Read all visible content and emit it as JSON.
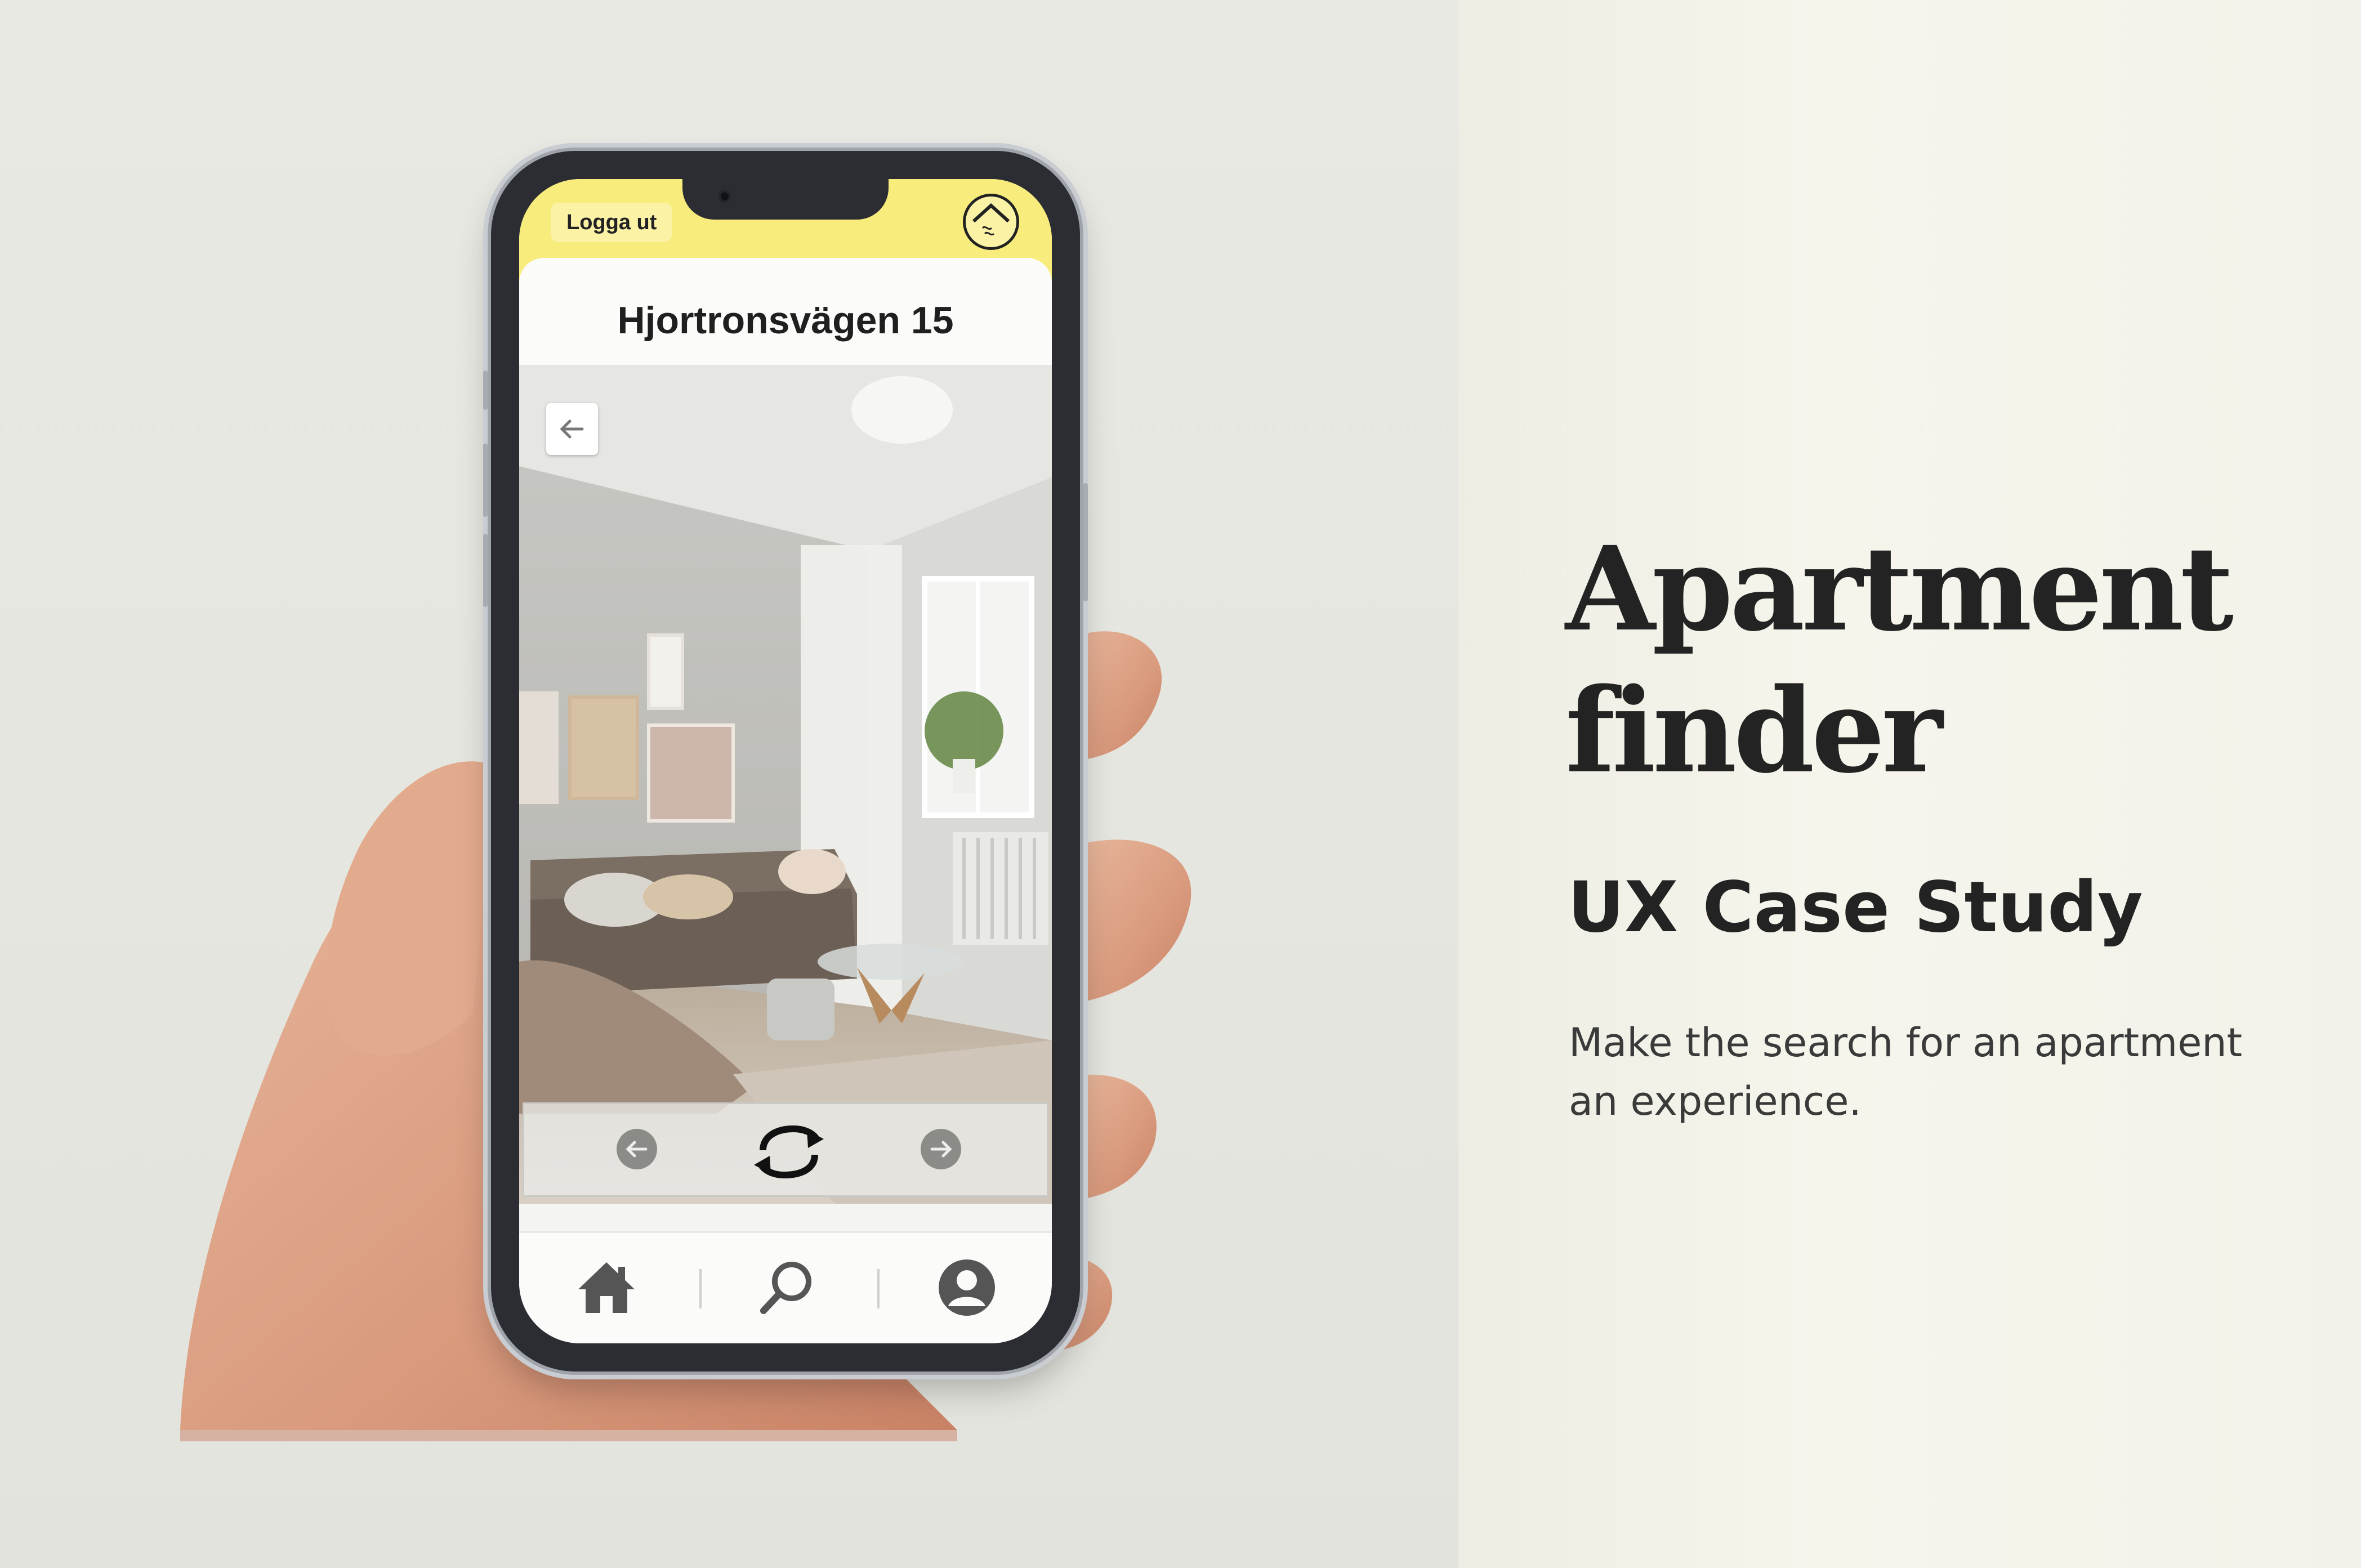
{
  "app": {
    "logout_label": "Logga ut",
    "address_title": "Hjortronsvägen 15"
  },
  "icons": {
    "back": "arrow-left-icon",
    "prev": "arrow-left-circle-icon",
    "next": "arrow-right-circle-icon",
    "rotate": "rotate-360-icon",
    "home": "home-icon",
    "search": "search-icon",
    "profile": "user-icon",
    "logo": "house-logo-icon"
  },
  "panel": {
    "headline_line1": "Apartment",
    "headline_line2": "finder",
    "subheading": "UX Case Study",
    "description": "Make the search for an apartment an experience."
  },
  "colors": {
    "accent_yellow": "#f8ec7c",
    "text_dark": "#232323"
  }
}
